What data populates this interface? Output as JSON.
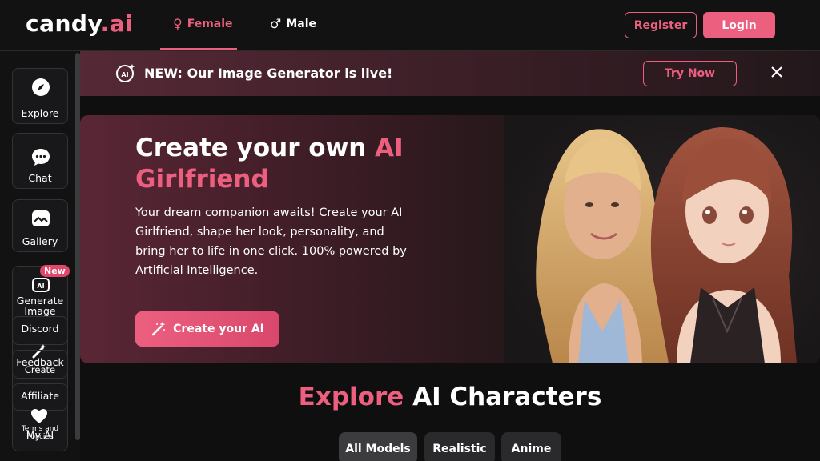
{
  "header": {
    "logo_text": "candy",
    "logo_accent": ".ai",
    "tabs": [
      {
        "label": "Female",
        "symbol": "♀"
      },
      {
        "label": "Male",
        "symbol": "♂"
      }
    ],
    "register_label": "Register",
    "login_label": "Login"
  },
  "sidebar": {
    "items": [
      {
        "label": "Explore",
        "icon": "compass-icon"
      },
      {
        "label": "Chat",
        "icon": "chat-bubble-icon"
      },
      {
        "label": "Gallery",
        "icon": "image-icon"
      },
      {
        "label": "Generate Image",
        "icon": "ai-image-icon",
        "badge": "New"
      },
      {
        "label": "Discord",
        "icon": "discord-icon"
      },
      {
        "label": "Feedback",
        "icon": "magic-wand-icon"
      },
      {
        "label": "Create",
        "icon": "magic-wand-icon"
      },
      {
        "label": "Affiliate",
        "icon": "affiliate-icon"
      },
      {
        "label": "My AI",
        "icon": "heart-icon"
      },
      {
        "label": "Terms and Policies",
        "icon": "document-icon"
      }
    ],
    "generate_line1": "Generate",
    "generate_line2": "Image",
    "terms_line1": "Terms and",
    "terms_line2": "Policies"
  },
  "announcement": {
    "prefix": "NEW:",
    "text": "Our Image Generator is live!",
    "button_label": "Try Now"
  },
  "hero": {
    "title_part1": "Create your own",
    "title_accent": "AI Girlfriend",
    "description": "Your dream companion awaits! Create your AI Girlfriend, shape her look, personality, and bring her to life in one click. 100% powered by Artificial Intelligence.",
    "button_label": "Create your AI"
  },
  "explore": {
    "title_accent": "Explore",
    "title_rest": "AI Characters",
    "filters": [
      "All Models",
      "Realistic",
      "Anime"
    ],
    "active_filter": "All Models"
  },
  "colors": {
    "accent": "#ec5f7f",
    "background": "#0f0f10"
  }
}
